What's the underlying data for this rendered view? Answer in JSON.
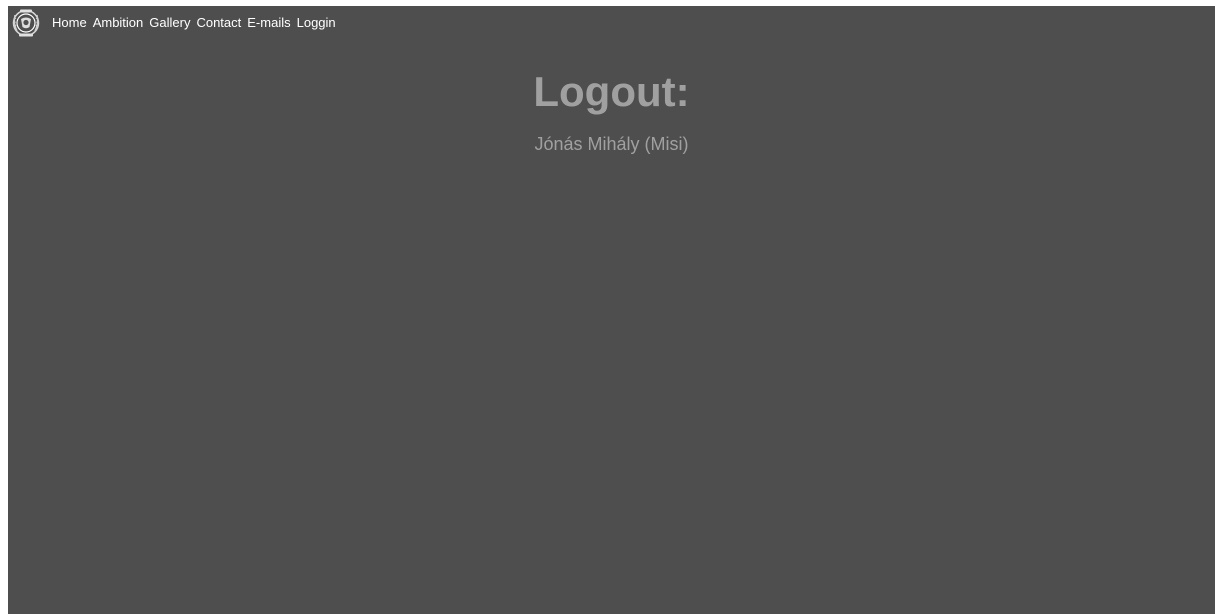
{
  "nav": {
    "logo_icon": "laurel-emblem-icon",
    "items": [
      {
        "label": "Home"
      },
      {
        "label": "Ambition"
      },
      {
        "label": "Gallery"
      },
      {
        "label": "Contact"
      },
      {
        "label": "E-mails"
      },
      {
        "label": "Loggin"
      }
    ]
  },
  "main": {
    "title": "Logout:",
    "user_name": "Jónás Mihály (Misi)"
  },
  "colors": {
    "background": "#4e4e4e",
    "nav_text": "#ffffff",
    "muted_text": "#a0a0a0"
  }
}
